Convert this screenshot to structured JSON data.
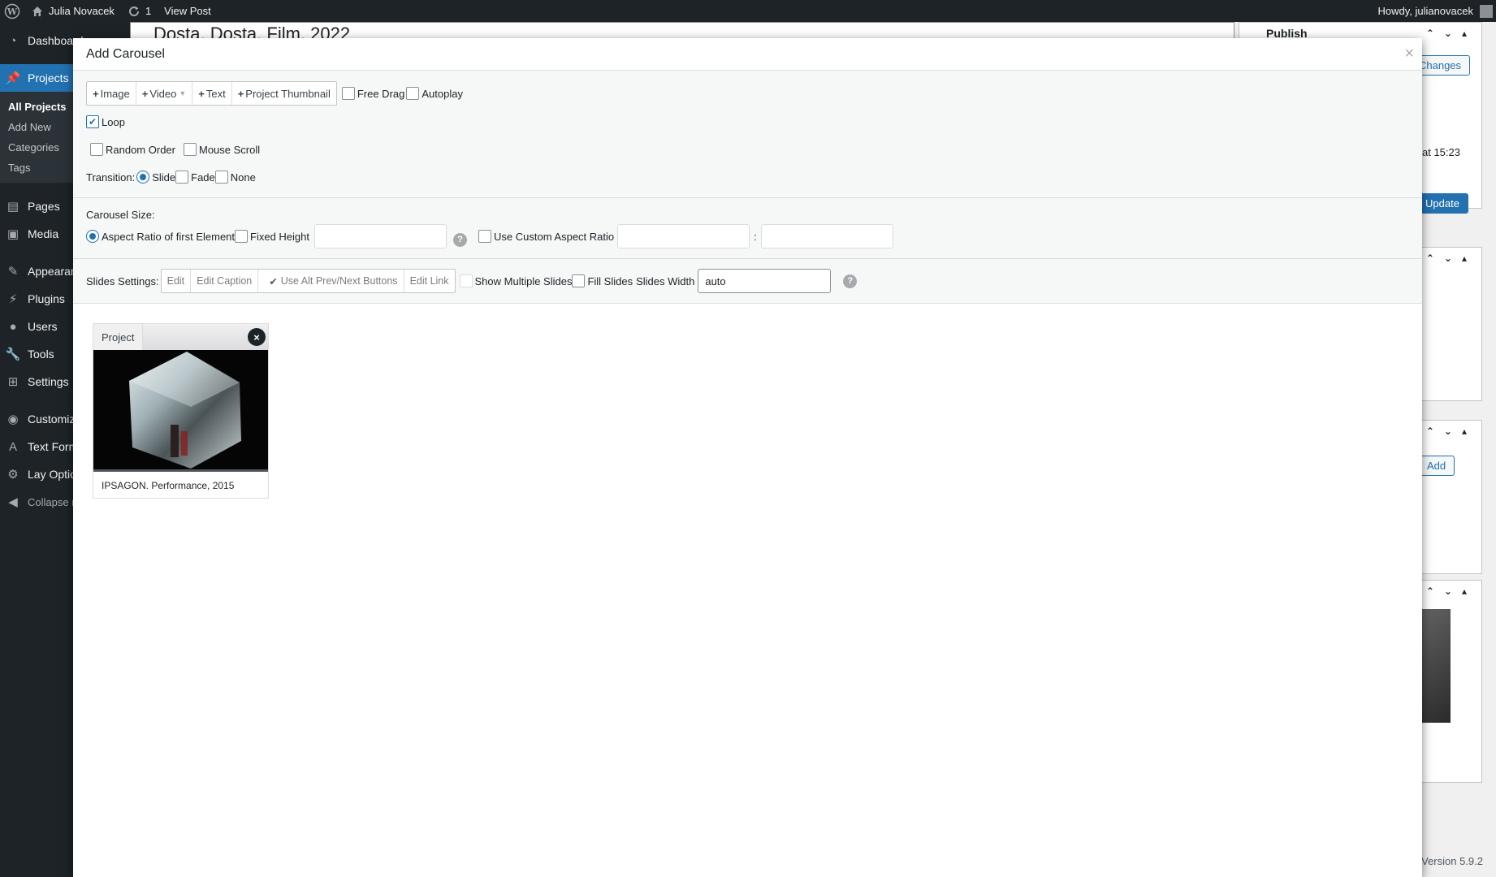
{
  "adminbar": {
    "site_name": "Julia Novacek",
    "updates_count": "1",
    "view_post": "View Post",
    "greeting": "Howdy, julianovacek"
  },
  "menu": {
    "dashboard": "Dashboard",
    "projects": "Projects",
    "projects_sub": [
      "All Projects",
      "Add New",
      "Categories",
      "Tags"
    ],
    "pages": "Pages",
    "media": "Media",
    "appearance": "Appearance",
    "plugins": "Plugins",
    "users": "Users",
    "tools": "Tools",
    "settings": "Settings",
    "customize": "Customize",
    "text_formats": "Text Formats",
    "lay_options": "Lay Options",
    "collapse": "Collapse menu"
  },
  "background": {
    "post_title": "Dosta, Dosta. Film, 2022",
    "publish_title": "Publish",
    "preview_changes": "Changes",
    "published_at": "at 15:23",
    "update_button": "Update",
    "add_button": "Add",
    "version": "Version 5.9.2"
  },
  "modal": {
    "title": "Add Carousel",
    "close": "×",
    "add_buttons": {
      "image": "Image",
      "video": "Video",
      "text": "Text",
      "project_thumbnail": "Project Thumbnail"
    },
    "options": {
      "free_drag": "Free Drag",
      "autoplay": "Autoplay",
      "loop": "Loop",
      "random_order": "Random Order",
      "mouse_scroll": "Mouse Scroll"
    },
    "transition": {
      "label": "Transition:",
      "slide": "Slide",
      "fade": "Fade",
      "none": "None"
    },
    "size": {
      "label": "Carousel Size:",
      "aspect_first": "Aspect Ratio of first Element",
      "fixed_height": "Fixed Height",
      "custom_aspect": "Use Custom Aspect Ratio",
      "ratio_sep": ":"
    },
    "slides_settings": {
      "label": "Slides Settings:",
      "edit": "Edit",
      "edit_caption": "Edit Caption",
      "alt_buttons": "Use Alt Prev/Next Buttons",
      "edit_link": "Edit Link",
      "show_multiple": "Show Multiple Slides",
      "fill_slides": "Fill Slides",
      "slides_width_label": "Slides Width",
      "slides_width_value": "auto"
    },
    "help": "?",
    "slide": {
      "tag": "Project",
      "remove": "×",
      "caption": "IPSAGON. Performance, 2015"
    }
  },
  "colors": {
    "accent": "#2271b1",
    "admin_dark": "#1d2327"
  }
}
